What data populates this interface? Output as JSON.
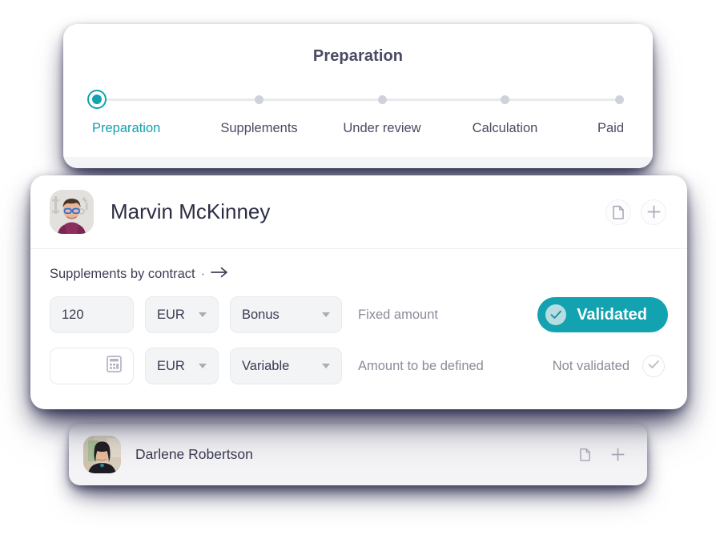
{
  "stepper": {
    "title": "Preparation",
    "active_color": "#12a2b0",
    "steps": [
      {
        "label": "Preparation",
        "state": "active"
      },
      {
        "label": "Supplements",
        "state": "upcoming"
      },
      {
        "label": "Under review",
        "state": "upcoming"
      },
      {
        "label": "Calculation",
        "state": "upcoming"
      },
      {
        "label": "Paid",
        "state": "upcoming"
      }
    ]
  },
  "detail_card": {
    "person": {
      "name": "Marvin McKinney",
      "avatar": "photo-man-glasses"
    },
    "actions": [
      {
        "icon": "document-icon",
        "name": "document-button"
      },
      {
        "icon": "plus-icon",
        "name": "add-button"
      }
    ],
    "section": {
      "label": "Supplements by contract",
      "separator": "·",
      "arrow": "→"
    },
    "rows": [
      {
        "amount": "120",
        "amount_placeholder": "",
        "amount_icon": "",
        "currency": "EUR",
        "type": "Bonus",
        "description": "Fixed amount",
        "status_label": "Validated",
        "status": "validated",
        "status_color": "#12a2b0"
      },
      {
        "amount": "",
        "amount_placeholder": "",
        "amount_icon": "calculator-icon",
        "currency": "EUR",
        "type": "Variable",
        "description": "Amount to be defined",
        "status_label": "Not validated",
        "status": "not-validated",
        "status_color": "#8a8c9b"
      }
    ]
  },
  "list_card": {
    "person": {
      "name": "Darlene Robertson",
      "avatar": "photo-woman"
    },
    "actions": [
      {
        "icon": "document-icon",
        "name": "document-button"
      },
      {
        "icon": "plus-icon",
        "name": "add-button"
      }
    ]
  }
}
